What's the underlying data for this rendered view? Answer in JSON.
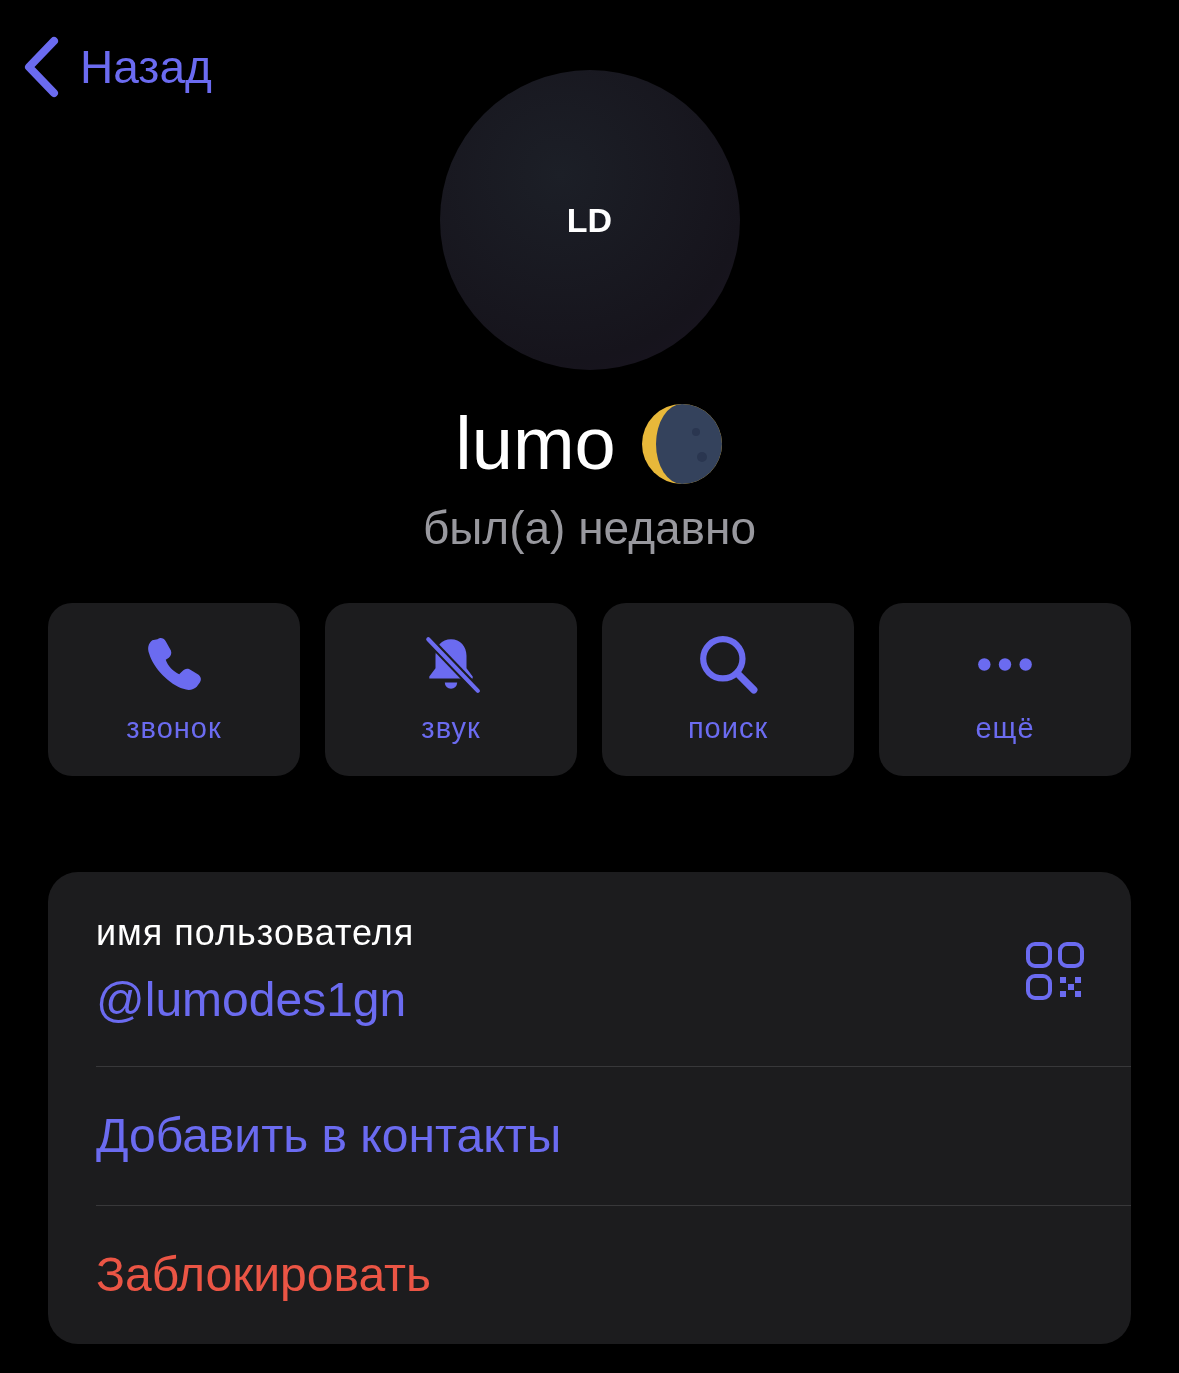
{
  "nav": {
    "back_label": "Назад"
  },
  "profile": {
    "avatar_text": "LD",
    "name": "lumo",
    "status": "был(а) недавно"
  },
  "actions": [
    {
      "kind": "call",
      "label": "звонок"
    },
    {
      "kind": "mute",
      "label": "звук"
    },
    {
      "kind": "search",
      "label": "поиск"
    },
    {
      "kind": "more",
      "label": "ещё"
    }
  ],
  "info": {
    "username_label": "имя пользователя",
    "username": "@lumodes1gn",
    "rows": [
      {
        "kind": "accent",
        "label": "Добавить в контакты"
      },
      {
        "kind": "destructive",
        "label": "Заблокировать"
      }
    ]
  }
}
